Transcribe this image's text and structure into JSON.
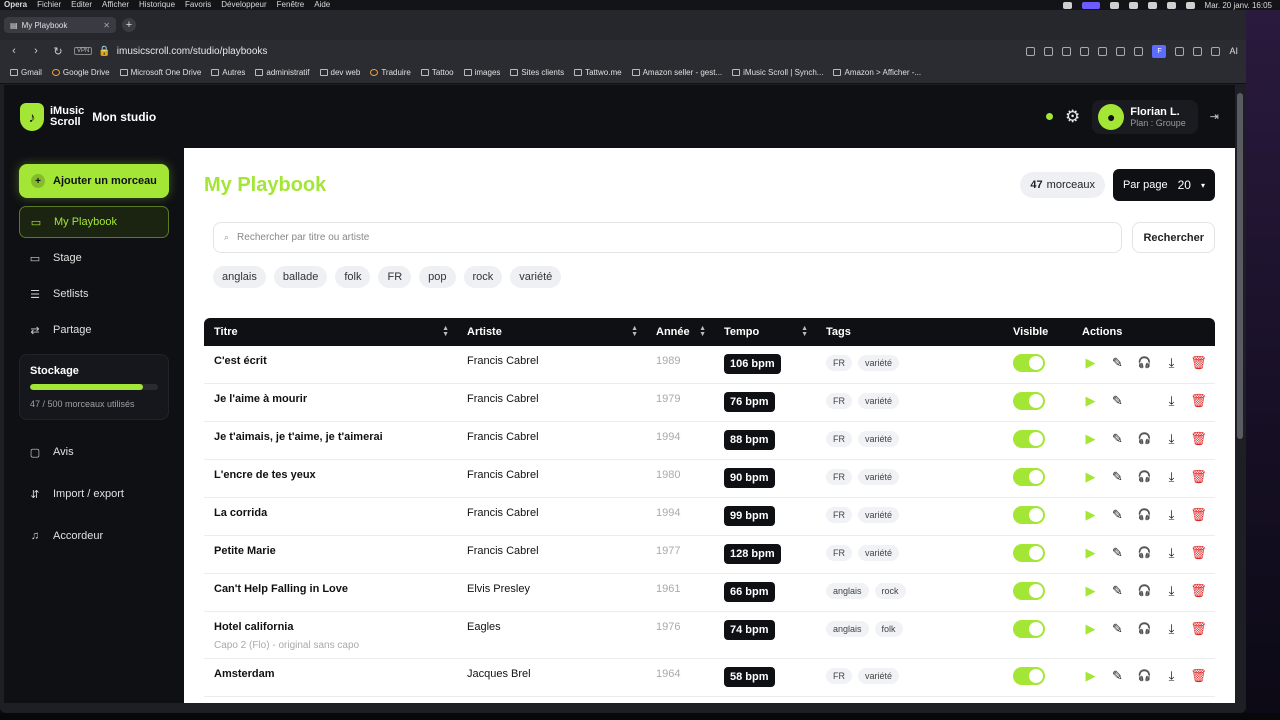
{
  "menubar": {
    "items": [
      "Opera",
      "Fichier",
      "Editer",
      "Afficher",
      "Historique",
      "Favoris",
      "Développeur",
      "Fenêtre",
      "Aide"
    ],
    "clock": "Mar. 20 janv. 16:05"
  },
  "browser": {
    "tab_title": "My Playbook",
    "url": "imusicscroll.com/studio/playbooks",
    "vpn": "VPN",
    "profile_letter": "F",
    "ai_label": "AI",
    "bookmarks": [
      "Gmail",
      "Google Drive",
      "Microsoft One Drive",
      "Autres",
      "administratif",
      "dev web",
      "Traduire",
      "Tattoo",
      "images",
      "Sites clients",
      "Tattwo.me",
      "Amazon seller - gest...",
      "iMusic Scroll | Synch...",
      "Amazon > Afficher -..."
    ]
  },
  "header": {
    "logo_line1": "iMusic",
    "logo_line2": "Scroll",
    "studio": "Mon studio",
    "user_name": "Florian L.",
    "user_plan": "Plan : Groupe"
  },
  "sidebar": {
    "add_button": "Ajouter un morceau",
    "items": [
      {
        "label": "My Playbook",
        "icon": "playbook-icon"
      },
      {
        "label": "Stage",
        "icon": "stage-icon"
      },
      {
        "label": "Setlists",
        "icon": "list-icon"
      },
      {
        "label": "Partage",
        "icon": "share-icon"
      }
    ],
    "storage": {
      "title": "Stockage",
      "used": 47,
      "total": 500,
      "label": "47 / 500 morceaux utilisés"
    },
    "items2": [
      {
        "label": "Avis",
        "icon": "comment-icon"
      },
      {
        "label": "Import / export",
        "icon": "import-export-icon"
      },
      {
        "label": "Accordeur",
        "icon": "music-note-icon"
      }
    ]
  },
  "main": {
    "title": "My Playbook",
    "count_num": "47",
    "count_label": "morceaux",
    "per_page_label": "Par page",
    "per_page_value": "20",
    "search_placeholder": "Rechercher par titre ou artiste",
    "search_button": "Rechercher",
    "tag_filters": [
      "anglais",
      "ballade",
      "folk",
      "FR",
      "pop",
      "rock",
      "variété"
    ]
  },
  "table": {
    "headers": {
      "title": "Titre",
      "artist": "Artiste",
      "year": "Année",
      "tempo": "Tempo",
      "tags": "Tags",
      "visible": "Visible",
      "actions": "Actions"
    },
    "rows": [
      {
        "title": "C'est écrit",
        "subtitle": "",
        "artist": "Francis Cabrel",
        "year": "1989",
        "tempo": "106 bpm",
        "tags": [
          "FR",
          "variété"
        ],
        "visible": true,
        "stream": true
      },
      {
        "title": "Je l'aime à mourir",
        "subtitle": "",
        "artist": "Francis Cabrel",
        "year": "1979",
        "tempo": "76 bpm",
        "tags": [
          "FR",
          "variété"
        ],
        "visible": true,
        "stream": false
      },
      {
        "title": "Je t'aimais, je t'aime, je t'aimerai",
        "subtitle": "",
        "artist": "Francis Cabrel",
        "year": "1994",
        "tempo": "88 bpm",
        "tags": [
          "FR",
          "variété"
        ],
        "visible": true,
        "stream": true
      },
      {
        "title": "L'encre de tes yeux",
        "subtitle": "",
        "artist": "Francis Cabrel",
        "year": "1980",
        "tempo": "90 bpm",
        "tags": [
          "FR",
          "variété"
        ],
        "visible": true,
        "stream": true
      },
      {
        "title": "La corrida",
        "subtitle": "",
        "artist": "Francis Cabrel",
        "year": "1994",
        "tempo": "99 bpm",
        "tags": [
          "FR",
          "variété"
        ],
        "visible": true,
        "stream": true
      },
      {
        "title": "Petite Marie",
        "subtitle": "",
        "artist": "Francis Cabrel",
        "year": "1977",
        "tempo": "128 bpm",
        "tags": [
          "FR",
          "variété"
        ],
        "visible": true,
        "stream": true
      },
      {
        "title": "Can't Help Falling in Love",
        "subtitle": "",
        "artist": "Elvis Presley",
        "year": "1961",
        "tempo": "66 bpm",
        "tags": [
          "anglais",
          "rock"
        ],
        "visible": true,
        "stream": true
      },
      {
        "title": "Hotel california",
        "subtitle": "Capo 2 (Flo) - original sans capo",
        "artist": "Eagles",
        "year": "1976",
        "tempo": "74 bpm",
        "tags": [
          "anglais",
          "folk"
        ],
        "visible": true,
        "stream": true
      },
      {
        "title": "Amsterdam",
        "subtitle": "",
        "artist": "Jacques Brel",
        "year": "1964",
        "tempo": "58 bpm",
        "tags": [
          "FR",
          "variété"
        ],
        "visible": true,
        "stream": true
      }
    ]
  }
}
